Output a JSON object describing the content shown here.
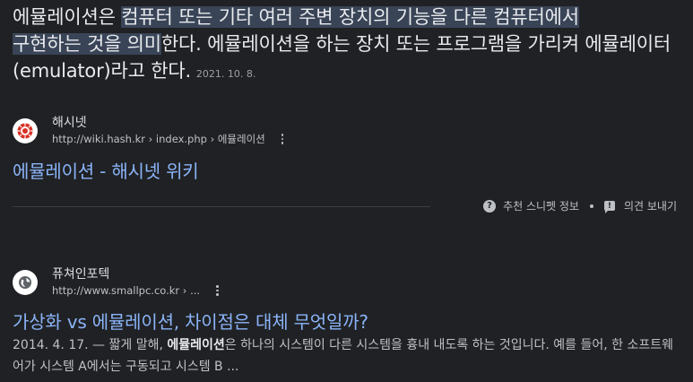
{
  "featured_snippet": {
    "highlight_part1": "컴퓨터 또는 기타 여러 주변 장치의 기능을 다른 컴퓨터에서",
    "text_before": "에뮬레이션은 ",
    "highlight_part2": "구현하는 것을 의미",
    "text_after": "한다. 에뮬레이션을 하는 장치 또는 프로그램을 가리켜 에뮬레이터(emulator)라고 한다.",
    "date": "2021. 10. 8."
  },
  "result1": {
    "site_name": "해시넷",
    "url": "http://wiki.hash.kr › index.php › 에뮬레이션",
    "title": "에뮬레이션 - 해시넷 위키"
  },
  "feedback": {
    "about_label": "추천 스니펫 정보",
    "send_label": "의견 보내기"
  },
  "result2": {
    "site_name": "퓨쳐인포텍",
    "url": "http://www.smallpc.co.kr › ...",
    "title": "가상화 vs 에뮬레이션, 차이점은 대체 무엇일까?",
    "date_prefix": "2014. 4. 17. — 짧게 말해, ",
    "bold_term": "에뮬레이션",
    "text_rest": "은 하나의 시스템이 다른 시스템을 흉내 내도록 하는 것입니다. 예를 들어, 한 소프트웨어가 시스템 A에서는 구동되고 시스템 B ..."
  },
  "colors": {
    "background": "#202124",
    "link": "#8ab4f8",
    "highlight": "#394457",
    "text": "#e8eaed",
    "muted": "#bdc1c6"
  },
  "icons": {
    "result1_favicon": "hashnet-red-logo-icon",
    "result2_favicon": "globe-icon",
    "help": "question-circle-icon",
    "feedback": "feedback-flag-icon",
    "more": "more-vert-icon"
  }
}
